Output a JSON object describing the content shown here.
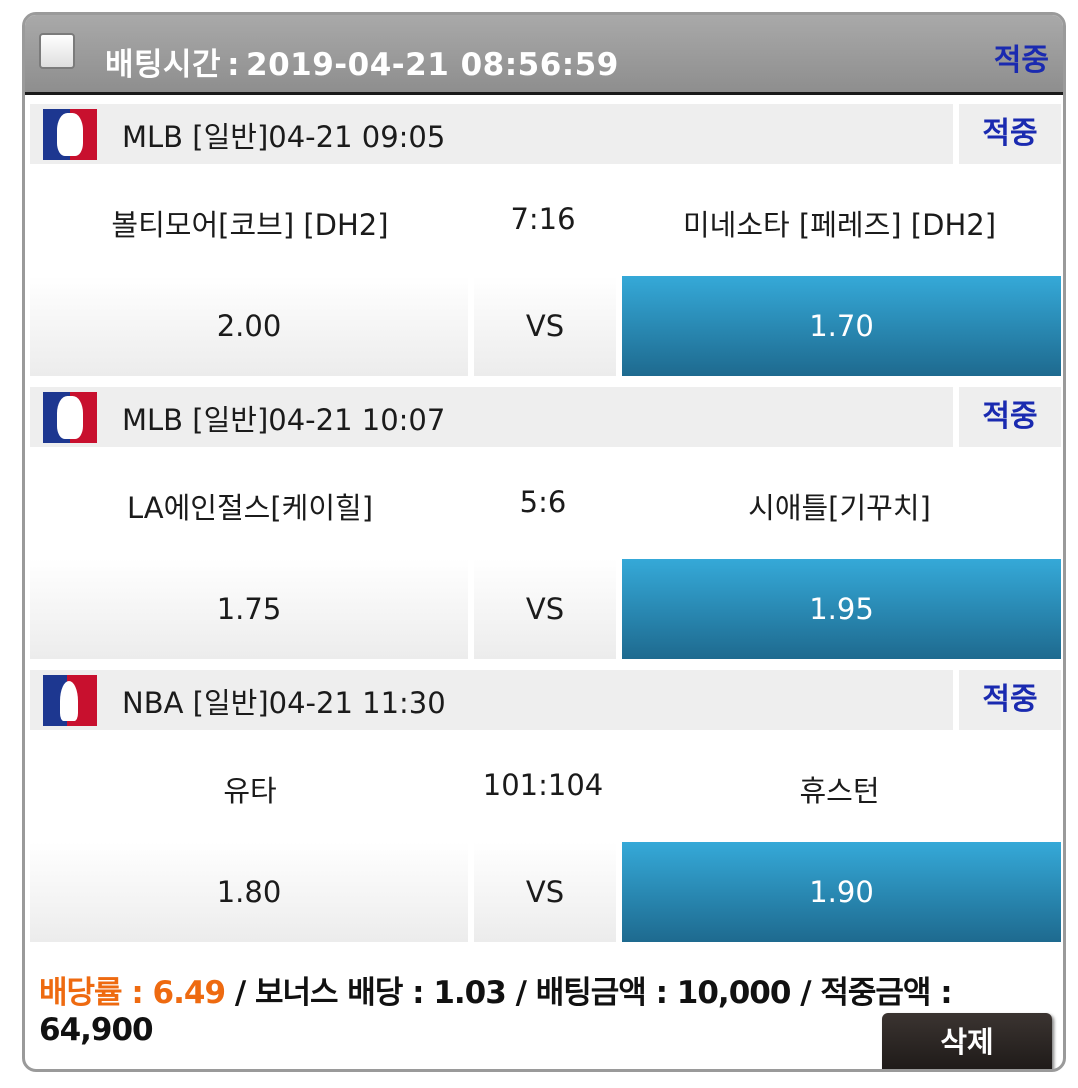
{
  "header": {
    "bet_time_label": "배팅시간",
    "bet_time_sep": ":",
    "bet_time_value": "2019-04-21 08:56:59",
    "status": "적중"
  },
  "games": [
    {
      "league_icon": "mlb-logo-icon",
      "title": "MLB [일반]04-21 09:05",
      "status": "적중",
      "home_team": "볼티모어[코브] [DH2]",
      "score": "7:16",
      "away_team": "미네소타 [페레즈] [DH2]",
      "home_odds": "2.00",
      "vs_label": "VS",
      "away_odds": "1.70"
    },
    {
      "league_icon": "mlb-logo-icon",
      "title": "MLB [일반]04-21 10:07",
      "status": "적중",
      "home_team": "LA에인절스[케이힐]",
      "score": "5:6",
      "away_team": "시애틀[기꾸치]",
      "home_odds": "1.75",
      "vs_label": "VS",
      "away_odds": "1.95"
    },
    {
      "league_icon": "nba-logo-icon",
      "title": "NBA [일반]04-21 11:30",
      "status": "적중",
      "home_team": "유타",
      "score": "101:104",
      "away_team": "휴스턴",
      "home_odds": "1.80",
      "vs_label": "VS",
      "away_odds": "1.90"
    }
  ],
  "summary": {
    "odds_rate": "배당률 : 6.49",
    "bonus": "/ 보너스 배당 : 1.03",
    "bet_amount": "/ 배팅금액 : 10,000",
    "win_amount": "/ 적중금액 : 64,900"
  },
  "delete_label": "삭제",
  "colors": {
    "status": "#1a2ab0",
    "selected_odds": "#2a8fbd",
    "odds_rate": "#ee6a10"
  }
}
